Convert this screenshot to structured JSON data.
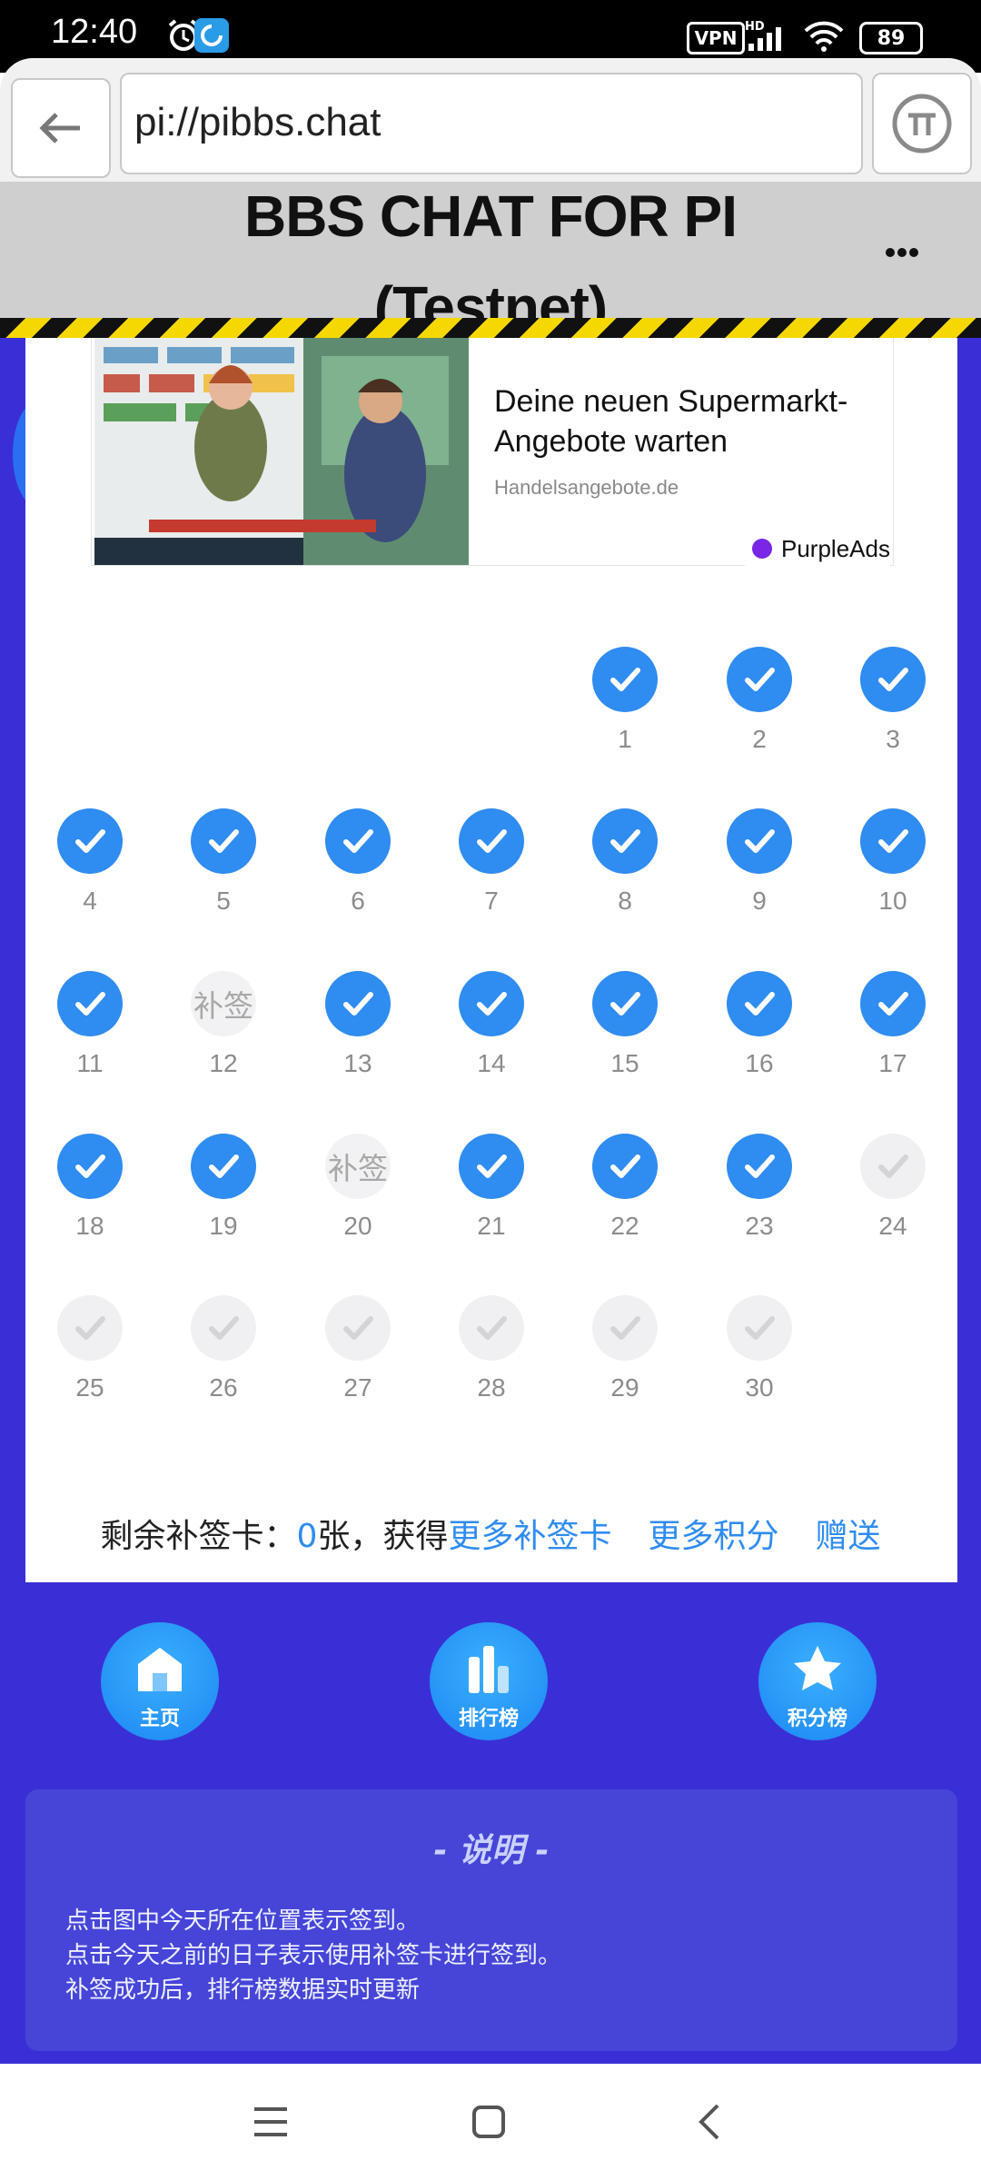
{
  "status_bar": {
    "time": "12:40",
    "vpn": "VPN",
    "network": "HD",
    "battery": "89"
  },
  "browser": {
    "url": "pi://pibbs.chat"
  },
  "site": {
    "title_line1": "BBS CHAT FOR PI",
    "title_line2": "(Testnet)"
  },
  "ad": {
    "headline": "Deine neuen Supermarkt-Angebote warten",
    "domain": "Handelsangebote.de",
    "network": "PurpleAds"
  },
  "calendar": {
    "makeup_label": "补签",
    "days": [
      {
        "day": "1",
        "state": "done"
      },
      {
        "day": "2",
        "state": "done"
      },
      {
        "day": "3",
        "state": "done"
      },
      {
        "day": "4",
        "state": "done"
      },
      {
        "day": "5",
        "state": "done"
      },
      {
        "day": "6",
        "state": "done"
      },
      {
        "day": "7",
        "state": "done"
      },
      {
        "day": "8",
        "state": "done"
      },
      {
        "day": "9",
        "state": "done"
      },
      {
        "day": "10",
        "state": "done"
      },
      {
        "day": "11",
        "state": "done"
      },
      {
        "day": "12",
        "state": "makeup"
      },
      {
        "day": "13",
        "state": "done"
      },
      {
        "day": "14",
        "state": "done"
      },
      {
        "day": "15",
        "state": "done"
      },
      {
        "day": "16",
        "state": "done"
      },
      {
        "day": "17",
        "state": "done"
      },
      {
        "day": "18",
        "state": "done"
      },
      {
        "day": "19",
        "state": "done"
      },
      {
        "day": "20",
        "state": "makeup"
      },
      {
        "day": "21",
        "state": "done"
      },
      {
        "day": "22",
        "state": "done"
      },
      {
        "day": "23",
        "state": "done"
      },
      {
        "day": "24",
        "state": "future"
      },
      {
        "day": "25",
        "state": "future"
      },
      {
        "day": "26",
        "state": "future"
      },
      {
        "day": "27",
        "state": "future"
      },
      {
        "day": "28",
        "state": "future"
      },
      {
        "day": "29",
        "state": "future"
      },
      {
        "day": "30",
        "state": "future"
      }
    ]
  },
  "makeup_cards": {
    "prefix": "剩余补签卡：",
    "count": "0",
    "suffix": "张，获得",
    "more_cards": "更多补签卡",
    "more_points": "更多积分",
    "gift": "赠送"
  },
  "nav": {
    "home": "主页",
    "ranking": "排行榜",
    "points_ranking": "积分榜"
  },
  "explain": {
    "title": "- 说明 -",
    "lines": [
      "点击图中今天所在位置表示签到。",
      "点击今天之前的日子表示使用补签卡进行签到。",
      "补签成功后，排行榜数据实时更新"
    ]
  },
  "colors": {
    "accent": "#2f8cf0",
    "page_bg": "#3a2fd7",
    "explain_bg": "#4645d8"
  }
}
